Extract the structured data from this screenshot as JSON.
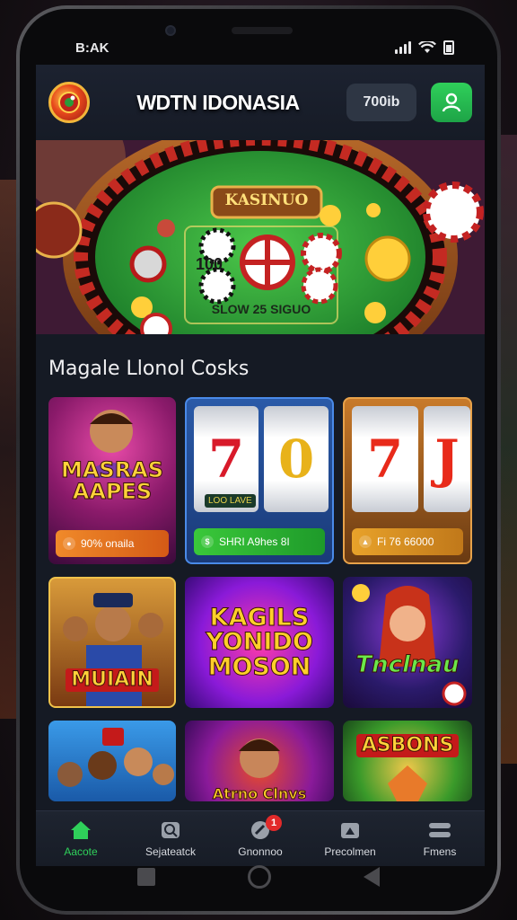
{
  "status_bar": {
    "time": "B:AK"
  },
  "header": {
    "brand": "WDTN IDONASIA",
    "balance": "700ib",
    "colors": {
      "accent": "#2fd05a"
    }
  },
  "banner": {
    "sign": "KASINUO",
    "felt_left": "100",
    "felt_bottom": "SLOW 25 SIGUO"
  },
  "section": {
    "title": "Magale Llonol Cosks"
  },
  "games": [
    {
      "title": "MASRAS AAPES",
      "badge": "90% onaila",
      "badge_icon": "coin-icon"
    },
    {
      "title": "770",
      "reel_sign": "LOO LAVE",
      "badge": "SHRI A9hes 8I",
      "badge_icon": "dollar-icon"
    },
    {
      "title": "77J",
      "badge": "Fi 76 66000",
      "badge_icon": "flame-icon"
    },
    {
      "title": "MUIAIN"
    },
    {
      "title": "KAGILS YONIDO MOSON"
    },
    {
      "title": "Tnclnau"
    },
    {
      "title": ""
    },
    {
      "title": "Atrno Clnvs"
    },
    {
      "title": "ASBONS"
    }
  ],
  "nav": {
    "items": [
      {
        "label": "Aacote",
        "icon": "home-icon",
        "active": true
      },
      {
        "label": "Sejateatck",
        "icon": "search-icon"
      },
      {
        "label": "Gnonnoo",
        "icon": "dice-icon",
        "badge": "1"
      },
      {
        "label": "Precolmen",
        "icon": "gift-icon"
      },
      {
        "label": "Fmens",
        "icon": "menu-icon"
      }
    ]
  }
}
